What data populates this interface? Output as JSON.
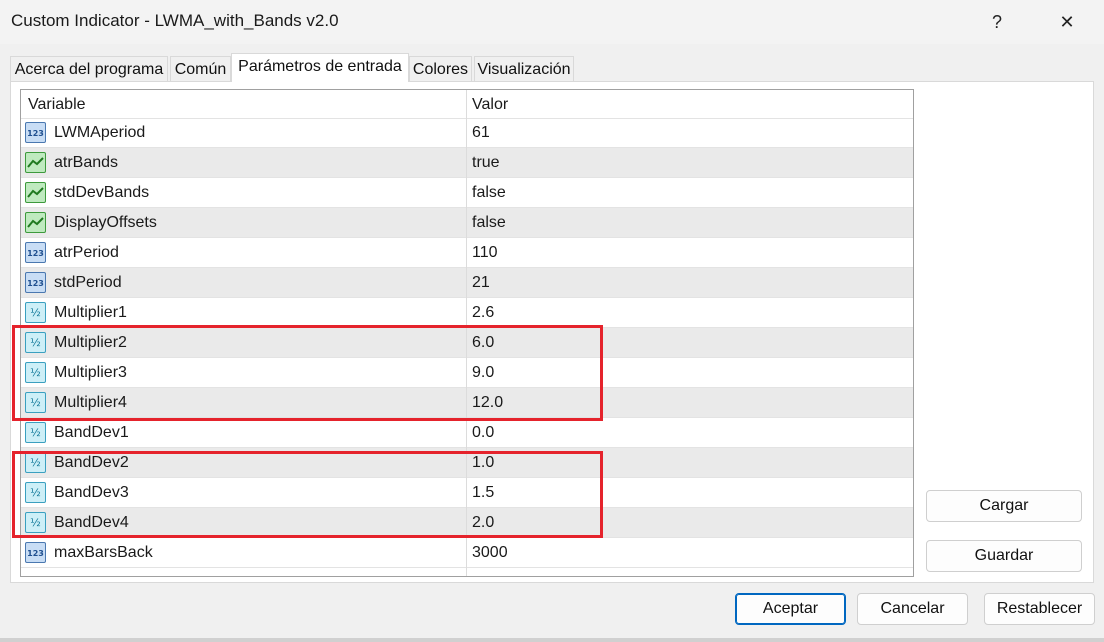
{
  "window": {
    "title": "Custom Indicator - LWMA_with_Bands v2.0",
    "help_glyph": "?",
    "close_glyph": "✕"
  },
  "tabs": [
    {
      "label": "Acerca del programa",
      "active": false
    },
    {
      "label": "Común",
      "active": false
    },
    {
      "label": "Parámetros de entrada",
      "active": true
    },
    {
      "label": "Colores",
      "active": false
    },
    {
      "label": "Visualización",
      "active": false
    }
  ],
  "grid": {
    "col_variable": "Variable",
    "col_value": "Valor",
    "rows": [
      {
        "type": "int-icon",
        "name": "LWMAperiod",
        "value": "61"
      },
      {
        "type": "bool-icon",
        "name": "atrBands",
        "value": "true"
      },
      {
        "type": "bool-icon",
        "name": "stdDevBands",
        "value": "false"
      },
      {
        "type": "bool-icon",
        "name": "DisplayOffsets",
        "value": "false"
      },
      {
        "type": "int-icon",
        "name": "atrPeriod",
        "value": "110"
      },
      {
        "type": "int-icon",
        "name": "stdPeriod",
        "value": "21"
      },
      {
        "type": "double-icon",
        "name": "Multiplier1",
        "value": "2.6"
      },
      {
        "type": "double-icon",
        "name": "Multiplier2",
        "value": "6.0"
      },
      {
        "type": "double-icon",
        "name": "Multiplier3",
        "value": "9.0"
      },
      {
        "type": "double-icon",
        "name": "Multiplier4",
        "value": "12.0"
      },
      {
        "type": "double-icon",
        "name": "BandDev1",
        "value": "0.0"
      },
      {
        "type": "double-icon",
        "name": "BandDev2",
        "value": "1.0"
      },
      {
        "type": "double-icon",
        "name": "BandDev3",
        "value": "1.5"
      },
      {
        "type": "double-icon",
        "name": "BandDev4",
        "value": "2.0"
      },
      {
        "type": "int-icon",
        "name": "maxBarsBack",
        "value": "3000"
      }
    ]
  },
  "side_buttons": {
    "load": "Cargar",
    "save": "Guardar"
  },
  "footer_buttons": {
    "ok": "Aceptar",
    "cancel": "Cancelar",
    "reset": "Restablecer"
  },
  "colors": {
    "highlight_box": "#e5232c",
    "accent": "#0067c0"
  }
}
